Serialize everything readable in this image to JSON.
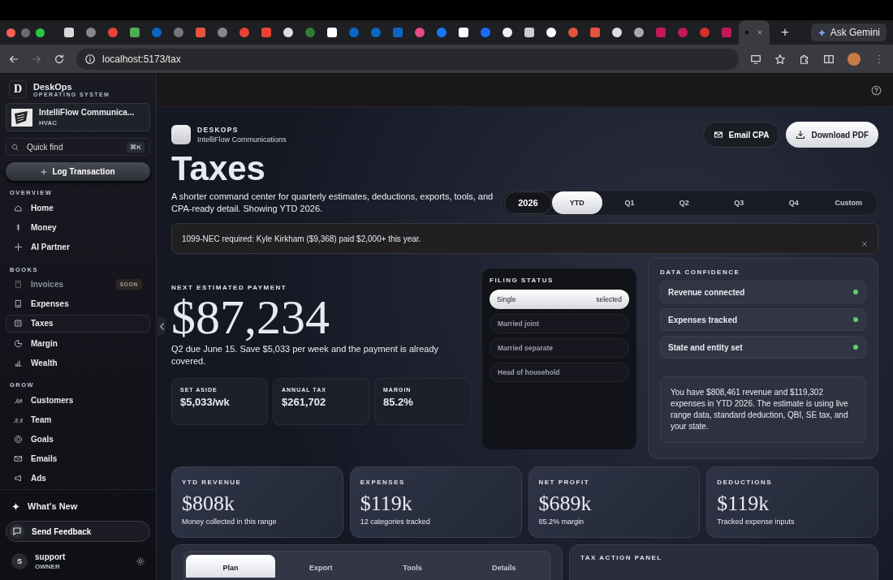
{
  "browser": {
    "new_tab": "+",
    "gemini": "Ask Gemini",
    "address": "localhost:5173/tax"
  },
  "sidebar": {
    "brand": {
      "letter": "D",
      "name": "DeskOps",
      "tagline": "OPERATING SYSTEM"
    },
    "company": {
      "name": "IntelliFlow Communica...",
      "industry": "HVAC"
    },
    "quick_find": {
      "placeholder": "Quick find",
      "shortcut": "⌘K"
    },
    "log_button": "Log Transaction",
    "sections": [
      {
        "title": "OVERVIEW",
        "items": [
          {
            "label": "Home",
            "selected": false,
            "disabled": false
          },
          {
            "label": "Money",
            "selected": false,
            "disabled": false
          },
          {
            "label": "AI Partner",
            "selected": false,
            "disabled": false
          }
        ]
      },
      {
        "title": "BOOKS",
        "items": [
          {
            "label": "Invoices",
            "selected": false,
            "disabled": true,
            "badge": "SOON"
          },
          {
            "label": "Expenses",
            "selected": false,
            "disabled": false
          },
          {
            "label": "Taxes",
            "selected": true,
            "disabled": false
          },
          {
            "label": "Margin",
            "selected": false,
            "disabled": false
          },
          {
            "label": "Wealth",
            "selected": false,
            "disabled": false
          }
        ]
      },
      {
        "title": "GROW",
        "items": [
          {
            "label": "Customers",
            "selected": false,
            "disabled": false
          },
          {
            "label": "Team",
            "selected": false,
            "disabled": false
          },
          {
            "label": "Goals",
            "selected": false,
            "disabled": false
          },
          {
            "label": "Emails",
            "selected": false,
            "disabled": false
          },
          {
            "label": "Ads",
            "selected": false,
            "disabled": false
          }
        ]
      }
    ],
    "whats_new": "What's New",
    "feedback": "Send Feedback",
    "user": {
      "initial": "S",
      "name": "support",
      "role": "OWNER"
    }
  },
  "header": {
    "brand": "DESKOPS",
    "company": "IntelliFlow Communications",
    "buttons": [
      {
        "label": "Email CPA",
        "kind": "secondary"
      },
      {
        "label": "Download PDF",
        "kind": "primary"
      }
    ]
  },
  "title": "Taxes",
  "description": "A shorter command center for quarterly estimates, deductions, exports, tools, and CPA-ready detail. Showing YTD 2026.",
  "year": "2026",
  "periods": [
    {
      "label": "YTD",
      "selected": true
    },
    {
      "label": "Q1",
      "selected": false
    },
    {
      "label": "Q2",
      "selected": false
    },
    {
      "label": "Q3",
      "selected": false
    },
    {
      "label": "Q4",
      "selected": false
    },
    {
      "label": "Custom",
      "selected": false
    }
  ],
  "alert": "1099-NEC required: Kyle Kirkham ($9,368) paid $2,000+ this year.",
  "payment": {
    "label": "NEXT ESTIMATED PAYMENT",
    "amount": "$87,234",
    "note": "Q2 due June 15. Save $5,033 per week and the payment is already covered.",
    "stats": [
      {
        "label": "SET ASIDE",
        "value": "$5,033/wk"
      },
      {
        "label": "ANNUAL TAX",
        "value": "$261,702"
      },
      {
        "label": "MARGIN",
        "value": "85.2%"
      }
    ]
  },
  "filing_status": {
    "title": "FILING STATUS",
    "options": [
      {
        "label": "Single",
        "selected": true,
        "tag": "selected"
      },
      {
        "label": "Married joint",
        "selected": false
      },
      {
        "label": "Married separate",
        "selected": false
      },
      {
        "label": "Head of household",
        "selected": false
      }
    ]
  },
  "data_confidence": {
    "title": "DATA CONFIDENCE",
    "items": [
      {
        "label": "Revenue connected",
        "ok": true
      },
      {
        "label": "Expenses tracked",
        "ok": true
      },
      {
        "label": "State and entity set",
        "ok": true
      }
    ],
    "summary": "You have $808,461 revenue and $119,302 expenses in YTD 2026. The estimate is using live range data, standard deduction, QBI, SE tax, and your state."
  },
  "metrics": [
    {
      "label": "YTD REVENUE",
      "value": "$808k",
      "note": "Money collected in this range"
    },
    {
      "label": "EXPENSES",
      "value": "$119k",
      "note": "12 categories tracked"
    },
    {
      "label": "NET PROFIT",
      "value": "$689k",
      "note": "85.2% margin"
    },
    {
      "label": "DEDUCTIONS",
      "value": "$119k",
      "note": "Tracked expense inputs"
    }
  ],
  "plan_tabs": [
    {
      "label": "Plan",
      "selected": true
    },
    {
      "label": "Export",
      "selected": false
    },
    {
      "label": "Tools",
      "selected": false
    },
    {
      "label": "Details",
      "selected": false
    }
  ],
  "action_panel": {
    "title": "TAX ACTION PANEL"
  }
}
